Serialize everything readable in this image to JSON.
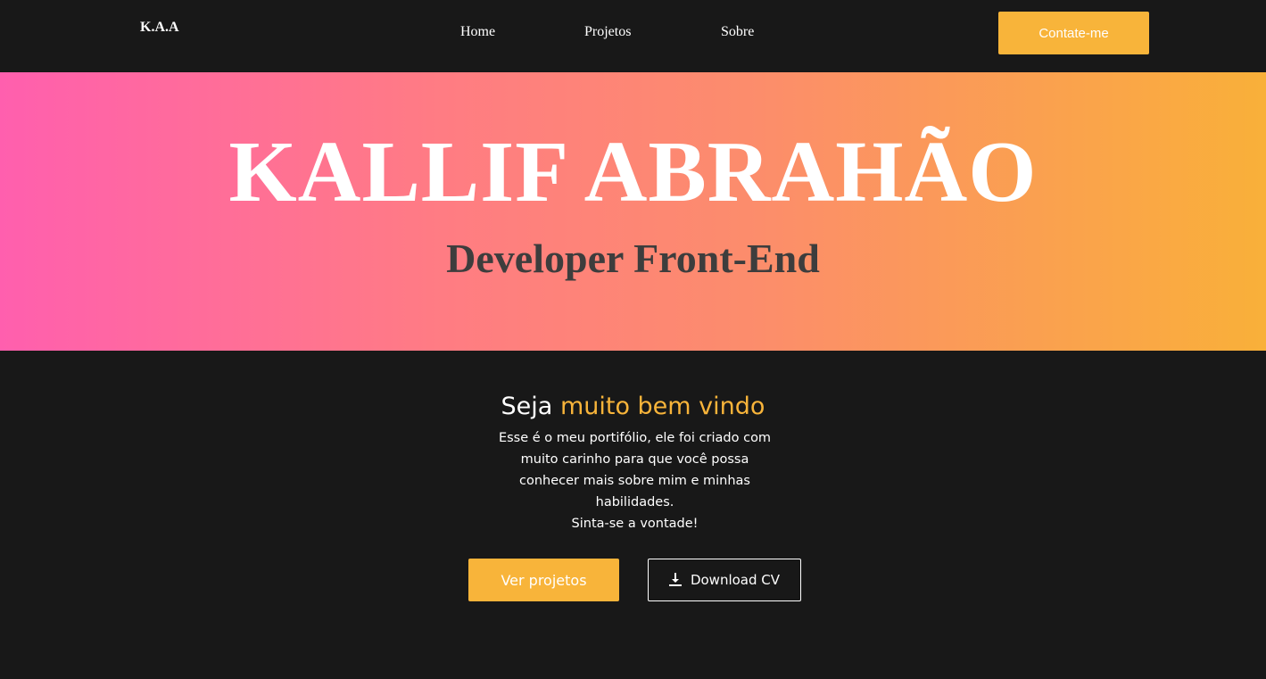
{
  "navbar": {
    "logo": "K.A.A",
    "links": [
      {
        "label": "Home"
      },
      {
        "label": "Projetos"
      },
      {
        "label": "Sobre"
      }
    ],
    "contact_button": "Contate-me"
  },
  "hero": {
    "name": "KALLIF ABRAHÃO",
    "role": "Developer Front-End",
    "gradient_colors": [
      "#ff5fae",
      "#f9b039"
    ]
  },
  "welcome": {
    "prefix": "Seja ",
    "highlight": "muito bem vindo",
    "accent_color": "#f8b43a",
    "intro_lines": [
      "Esse é o meu portifólio, ele foi criado com",
      "muito carinho para que você possa",
      "conhecer mais sobre mim e minhas",
      "habilidades.",
      "Sinta-se a vontade!"
    ]
  },
  "actions": {
    "projects_button": "Ver projetos",
    "cv_button": "Download CV",
    "cv_icon": "download-icon"
  }
}
